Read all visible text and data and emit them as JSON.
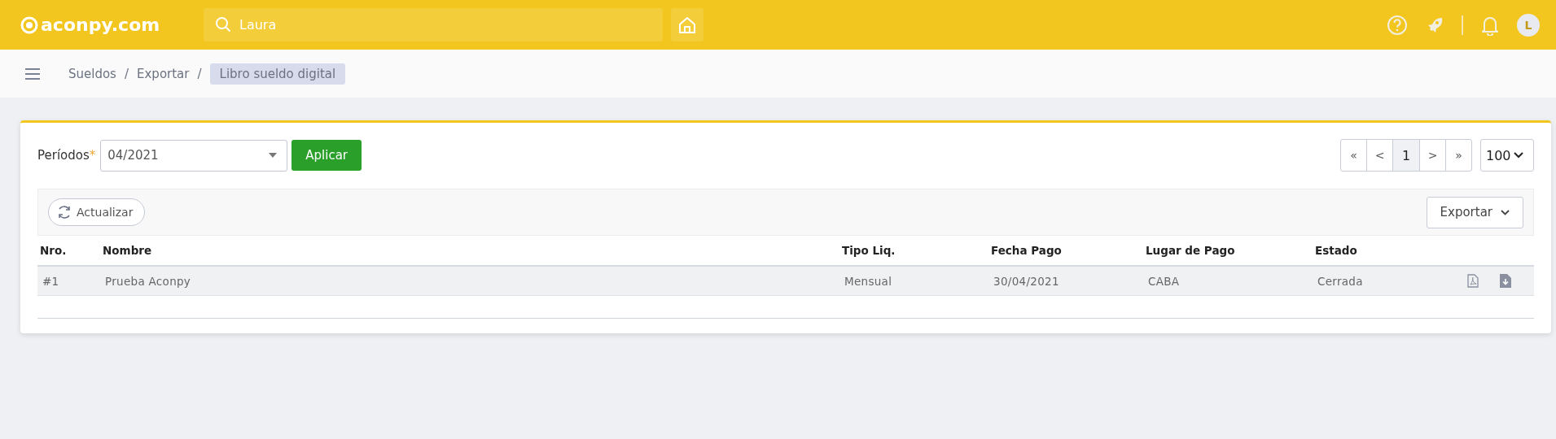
{
  "topbar": {
    "logo": "aconpy.com",
    "search": {
      "value": "Laura"
    },
    "avatar": "L"
  },
  "breadcrumbs": {
    "separator": "/",
    "items": [
      {
        "label": "Sueldos",
        "current": false
      },
      {
        "label": "Exportar",
        "current": false
      },
      {
        "label": "Libro sueldo digital",
        "current": true
      }
    ]
  },
  "filter": {
    "label": "Períodos",
    "required_mark": "*",
    "period": "04/2021",
    "apply": "Aplicar"
  },
  "pagination": {
    "pages": [
      {
        "label": "«",
        "selected": false
      },
      {
        "label": "<",
        "selected": false
      },
      {
        "label": "1",
        "selected": true
      },
      {
        "label": ">",
        "selected": false
      },
      {
        "label": "»",
        "selected": false
      }
    ],
    "page_size": "100"
  },
  "toolbar": {
    "refresh": "Actualizar",
    "export": "Exportar"
  },
  "table": {
    "columns": [
      "Nro.",
      "Nombre",
      "Tipo Liq.",
      "Fecha Pago",
      "Lugar de Pago",
      "Estado"
    ],
    "rows": [
      {
        "cells": [
          "#1",
          "Prueba Aconpy",
          "Mensual",
          "30/04/2021",
          "CABA",
          "Cerrada"
        ],
        "actions": [
          {
            "kind": "pdf"
          },
          {
            "kind": "download"
          }
        ]
      }
    ]
  }
}
